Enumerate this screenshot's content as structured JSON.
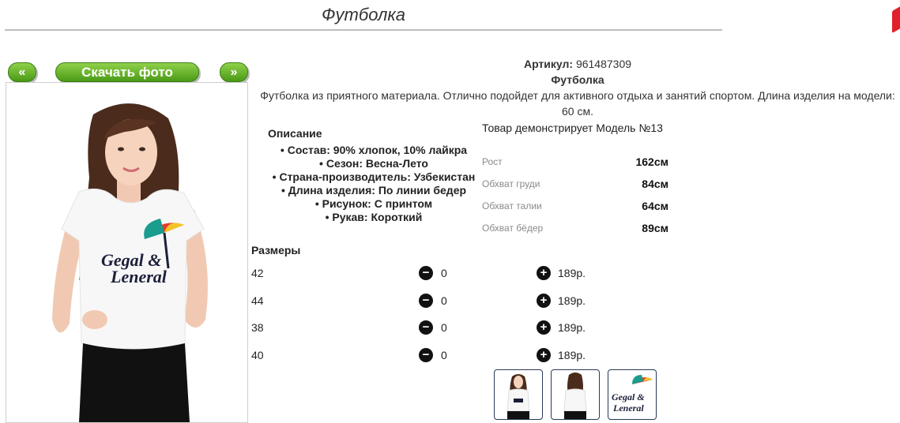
{
  "page": {
    "title": "Футболка"
  },
  "gallery": {
    "prev_label": "«",
    "download_label": "Скачать фото",
    "next_label": "»",
    "print_text_line1": "Gegal &",
    "print_text_line2": "Leneral",
    "colors": {
      "button_green": "#5aad1f",
      "shirt": "#f7f7f7",
      "hair": "#4a2b1c"
    }
  },
  "product": {
    "article_label": "Артикул:",
    "article_value": "961487309",
    "name": "Футболка",
    "description_line1": "Футболка из приятного материала. Отлично подойдет для активного отдыха и занятий спортом. Длина изделия на модели:",
    "description_line2": "60 см.",
    "specs_heading": "Описание",
    "specs": [
      "Состав: 90% хлопок, 10% лайкра",
      "Сезон: Весна-Лето",
      "Страна-производитель: Узбекистан",
      "Длина изделия: По линии бедер",
      "Рисунок: С принтом",
      "Рукав: Короткий"
    ]
  },
  "model": {
    "title": "Товар демонстрирует Модель №13",
    "measurements": [
      {
        "label": "Рост",
        "value": "162см"
      },
      {
        "label": "Обхват груди",
        "value": "84см"
      },
      {
        "label": "Обхват талии",
        "value": "64см"
      },
      {
        "label": "Обхват бёдер",
        "value": "89см"
      }
    ]
  },
  "sizes": {
    "heading": "Размеры",
    "rows": [
      {
        "size": "42",
        "qty": "0",
        "price": "189р."
      },
      {
        "size": "44",
        "qty": "0",
        "price": "189р."
      },
      {
        "size": "38",
        "qty": "0",
        "price": "189р."
      },
      {
        "size": "40",
        "qty": "0",
        "price": "189р."
      }
    ],
    "minus_icon": "minus-circle-icon",
    "plus_icon": "plus-circle-icon"
  },
  "thumbnails": {
    "print_text_line1": "Gegal &",
    "print_text_line2": "Leneral",
    "items": [
      "front-view",
      "back-view",
      "print-closeup"
    ]
  }
}
